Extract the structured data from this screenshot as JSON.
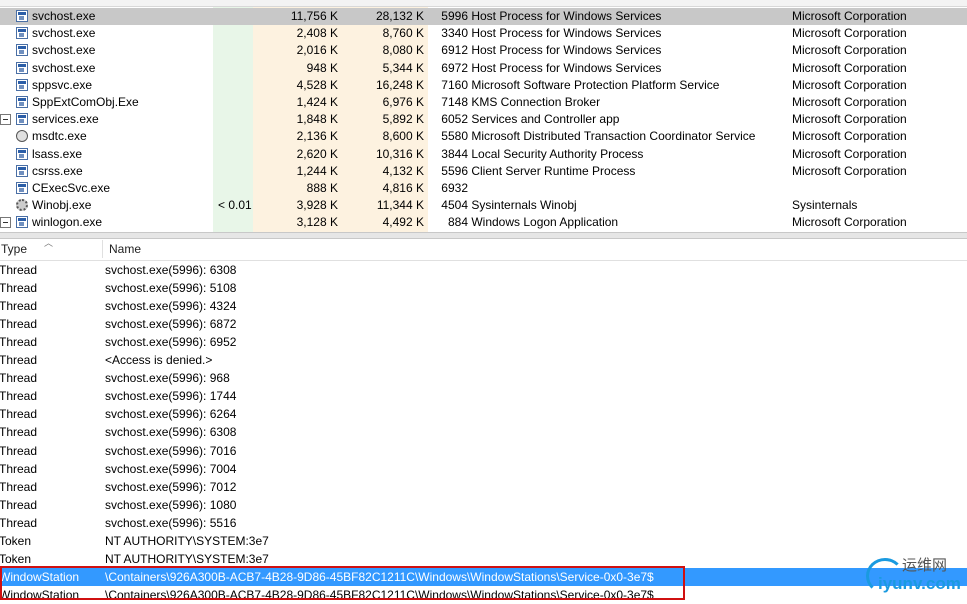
{
  "processes": [
    {
      "name": "svchost.exe",
      "cpu": "",
      "private": "11,756 K",
      "working": "28,132 K",
      "pid": "5996",
      "desc": "Host Process for Windows Services",
      "company": "Microsoft Corporation",
      "icon": "window-icon",
      "selected": true
    },
    {
      "name": "svchost.exe",
      "cpu": "",
      "private": "2,408 K",
      "working": "8,760 K",
      "pid": "3340",
      "desc": "Host Process for Windows Services",
      "company": "Microsoft Corporation",
      "icon": "window-icon"
    },
    {
      "name": "svchost.exe",
      "cpu": "",
      "private": "2,016 K",
      "working": "8,080 K",
      "pid": "6912",
      "desc": "Host Process for Windows Services",
      "company": "Microsoft Corporation",
      "icon": "window-icon"
    },
    {
      "name": "svchost.exe",
      "cpu": "",
      "private": "948 K",
      "working": "5,344 K",
      "pid": "6972",
      "desc": "Host Process for Windows Services",
      "company": "Microsoft Corporation",
      "icon": "window-icon"
    },
    {
      "name": "sppsvc.exe",
      "cpu": "",
      "private": "4,528 K",
      "working": "16,248 K",
      "pid": "7160",
      "desc": "Microsoft Software Protection Platform Service",
      "company": "Microsoft Corporation",
      "icon": "window-icon"
    },
    {
      "name": "SppExtComObj.Exe",
      "cpu": "",
      "private": "1,424 K",
      "working": "6,976 K",
      "pid": "7148",
      "desc": "KMS Connection Broker",
      "company": "Microsoft Corporation",
      "icon": "window-icon"
    },
    {
      "name": "services.exe",
      "cpu": "",
      "private": "1,848 K",
      "working": "5,892 K",
      "pid": "6052",
      "desc": "Services and Controller app",
      "company": "Microsoft Corporation",
      "icon": "window-icon",
      "collapse": true
    },
    {
      "name": "msdtc.exe",
      "cpu": "",
      "private": "2,136 K",
      "working": "8,600 K",
      "pid": "5580",
      "desc": "Microsoft Distributed Transaction Coordinator Service",
      "company": "Microsoft Corporation",
      "icon": "globe-icon"
    },
    {
      "name": "lsass.exe",
      "cpu": "",
      "private": "2,620 K",
      "working": "10,316 K",
      "pid": "3844",
      "desc": "Local Security Authority Process",
      "company": "Microsoft Corporation",
      "icon": "window-icon"
    },
    {
      "name": "csrss.exe",
      "cpu": "",
      "private": "1,244 K",
      "working": "4,132 K",
      "pid": "5596",
      "desc": "Client Server Runtime Process",
      "company": "Microsoft Corporation",
      "icon": "window-icon"
    },
    {
      "name": "CExecSvc.exe",
      "cpu": "",
      "private": "888 K",
      "working": "4,816 K",
      "pid": "6932",
      "desc": "",
      "company": "",
      "icon": "window-icon"
    },
    {
      "name": "Winobj.exe",
      "cpu": "< 0.01",
      "private": "3,928 K",
      "working": "11,344 K",
      "pid": "4504",
      "desc": "Sysinternals Winobj",
      "company": "Sysinternals",
      "icon": "gear-icon"
    },
    {
      "name": "winlogon.exe",
      "cpu": "",
      "private": "3,128 K",
      "working": "4,492 K",
      "pid": "884",
      "desc": "Windows Logon Application",
      "company": "Microsoft Corporation",
      "icon": "window-icon",
      "collapse": true
    }
  ],
  "lower": {
    "col_type": "Type",
    "col_name": "Name",
    "rows": [
      {
        "type": "Thread",
        "name": "svchost.exe(5996): 6308"
      },
      {
        "type": "Thread",
        "name": "svchost.exe(5996): 5108"
      },
      {
        "type": "Thread",
        "name": "svchost.exe(5996): 4324"
      },
      {
        "type": "Thread",
        "name": "svchost.exe(5996): 6872"
      },
      {
        "type": "Thread",
        "name": "svchost.exe(5996): 6952"
      },
      {
        "type": "Thread",
        "name": "<Access is denied.>"
      },
      {
        "type": "Thread",
        "name": "svchost.exe(5996): 968"
      },
      {
        "type": "Thread",
        "name": "svchost.exe(5996): 1744"
      },
      {
        "type": "Thread",
        "name": "svchost.exe(5996): 6264"
      },
      {
        "type": "Thread",
        "name": "svchost.exe(5996): 6308"
      },
      {
        "type": "Thread",
        "name": "svchost.exe(5996): 7016"
      },
      {
        "type": "Thread",
        "name": "svchost.exe(5996): 7004"
      },
      {
        "type": "Thread",
        "name": "svchost.exe(5996): 7012"
      },
      {
        "type": "Thread",
        "name": "svchost.exe(5996): 1080"
      },
      {
        "type": "Thread",
        "name": "svchost.exe(5996): 5516"
      },
      {
        "type": "Token",
        "name": "NT AUTHORITY\\SYSTEM:3e7"
      },
      {
        "type": "Token",
        "name": "NT AUTHORITY\\SYSTEM:3e7"
      },
      {
        "type": "WindowStation",
        "name": "\\Containers\\926A300B-ACB7-4B28-9D86-45BF82C1211C\\Windows\\WindowStations\\Service-0x0-3e7$",
        "selected": true
      },
      {
        "type": "WindowStation",
        "name": "\\Containers\\926A300B-ACB7-4B28-9D86-45BF82C1211C\\Windows\\WindowStations\\Service-0x0-3e7$"
      }
    ]
  },
  "watermark": {
    "line1": "运维网",
    "line2": "iyunv.com"
  },
  "colors": {
    "cpu_col": "#e8f6e8",
    "private_col": "#fdf2e0",
    "working_col": "#fdf2e0",
    "row_selected": "#c8c8c8",
    "handle_selected": "#3399ff",
    "highlight_box": "#d01010"
  }
}
